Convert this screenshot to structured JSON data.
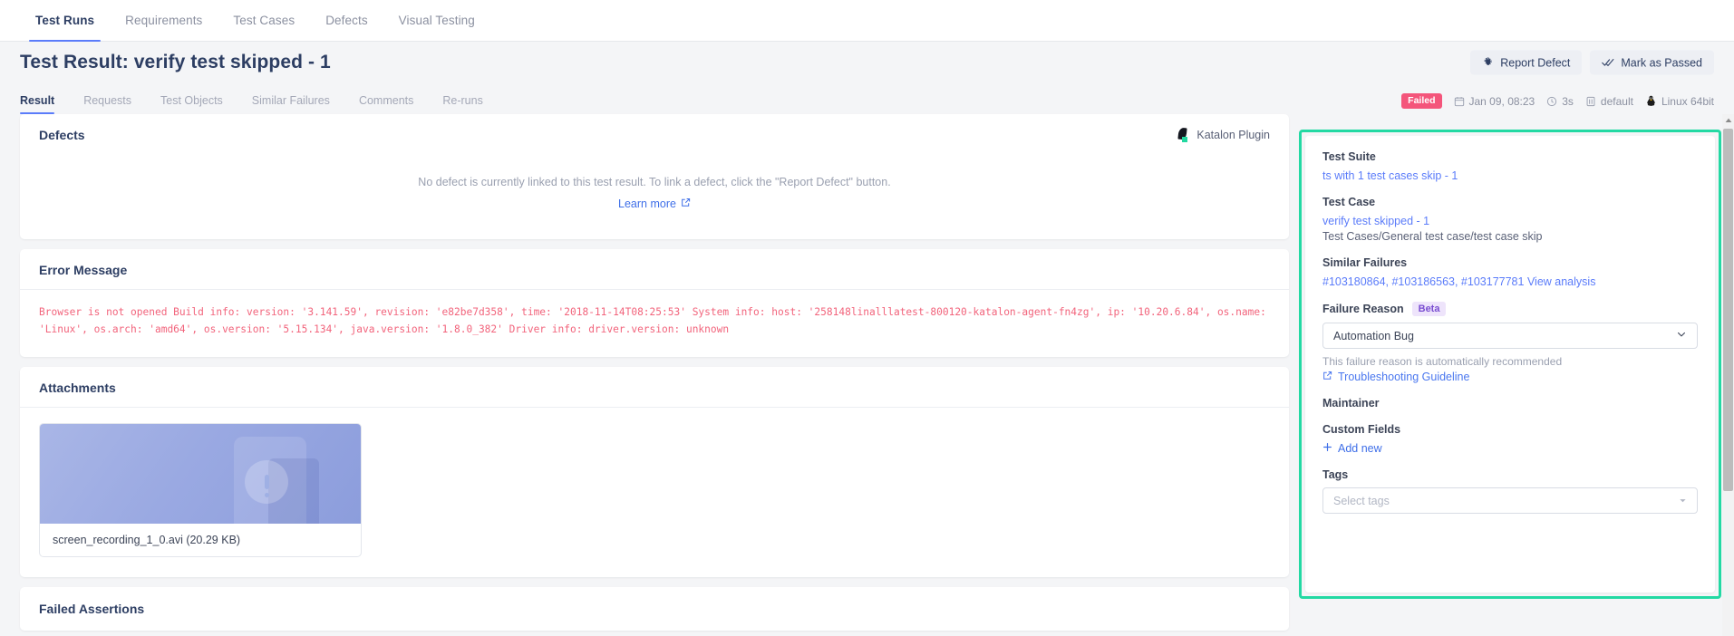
{
  "topnav": {
    "items": [
      {
        "label": "Test Runs",
        "active": true
      },
      {
        "label": "Requirements",
        "active": false
      },
      {
        "label": "Test Cases",
        "active": false
      },
      {
        "label": "Defects",
        "active": false
      },
      {
        "label": "Visual Testing",
        "active": false
      }
    ]
  },
  "header": {
    "title": "Test Result: verify test skipped - 1",
    "report_defect_label": "Report Defect",
    "mark_passed_label": "Mark as Passed"
  },
  "subtabs": {
    "items": [
      {
        "label": "Result",
        "active": true
      },
      {
        "label": "Requests",
        "active": false
      },
      {
        "label": "Test Objects",
        "active": false
      },
      {
        "label": "Similar Failures",
        "active": false
      },
      {
        "label": "Comments",
        "active": false
      },
      {
        "label": "Re-runs",
        "active": false
      }
    ]
  },
  "meta": {
    "status": "Failed",
    "status_color": "#f4557b",
    "date": "Jan 09, 08:23",
    "duration": "3s",
    "profile": "default",
    "platform": "Linux 64bit"
  },
  "defects": {
    "title": "Defects",
    "plugin_label": "Katalon Plugin",
    "empty_message": "No defect is currently linked to this test result. To link a defect, click the \"Report Defect\" button.",
    "learn_more_label": "Learn more"
  },
  "error_message": {
    "title": "Error Message",
    "text": "Browser is not opened Build info: version: '3.141.59', revision: 'e82be7d358', time: '2018-11-14T08:25:53' System info: host: '258148linalllatest-800120-katalon-agent-fn4zg', ip: '10.20.6.84', os.name: 'Linux', os.arch: 'amd64', os.version: '5.15.134', java.version: '1.8.0_382' Driver info: driver.version: unknown"
  },
  "attachments": {
    "title": "Attachments",
    "file_name": "screen_recording_1_0.avi (20.29 KB)"
  },
  "failed_assertions": {
    "title": "Failed Assertions"
  },
  "sidebar": {
    "test_suite": {
      "label": "Test Suite",
      "value": "ts with 1 test cases skip - 1"
    },
    "test_case": {
      "label": "Test Case",
      "value": "verify test skipped - 1",
      "path": "Test Cases/General test case/test case skip"
    },
    "similar_failures": {
      "label": "Similar Failures",
      "ids": "#103180864, #103186563, #103177781",
      "view_analysis_label": "View analysis"
    },
    "failure_reason": {
      "label": "Failure Reason",
      "badge": "Beta",
      "selected": "Automation Bug",
      "hint": "This failure reason is automatically recommended",
      "guideline_label": "Troubleshooting Guideline"
    },
    "maintainer": {
      "label": "Maintainer"
    },
    "custom_fields": {
      "label": "Custom Fields",
      "add_new_label": "Add new"
    },
    "tags": {
      "label": "Tags",
      "placeholder": "Select tags"
    }
  },
  "highlight": {
    "color": "#23d9a3"
  }
}
